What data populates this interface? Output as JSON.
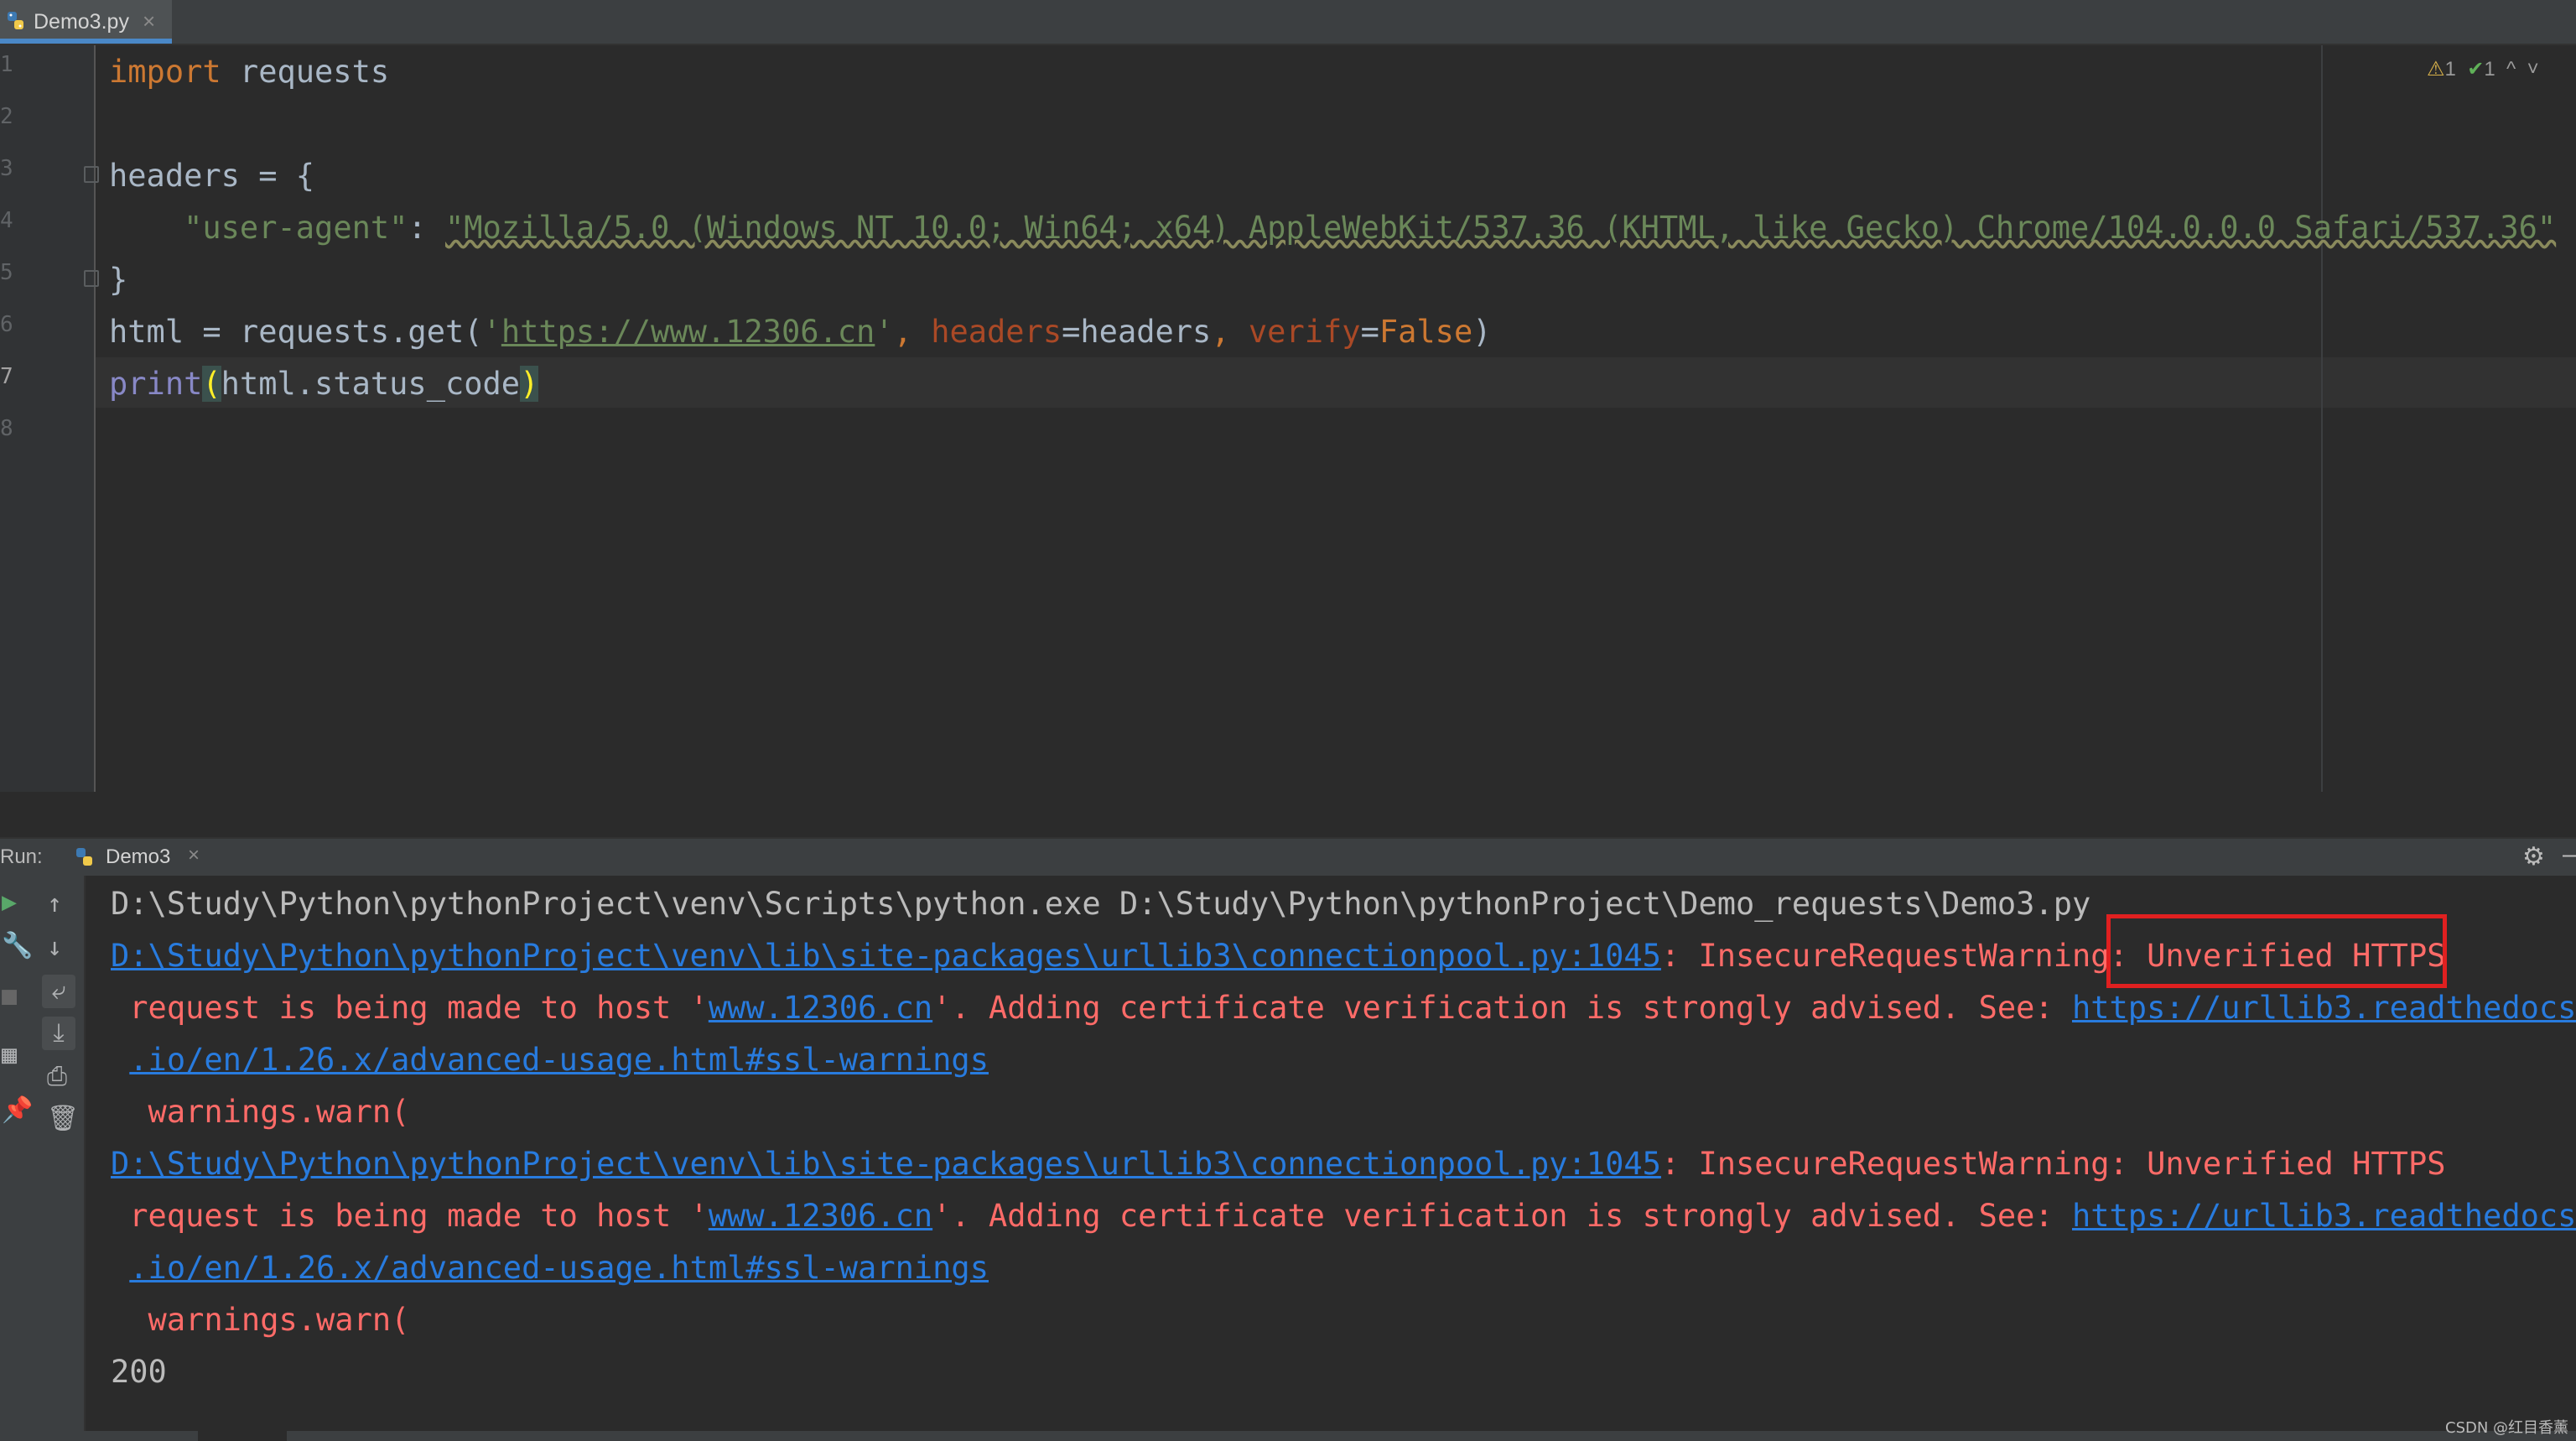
{
  "tab": {
    "filename": "Demo3.py",
    "close_glyph": "×",
    "icon": "python-file-icon"
  },
  "editor": {
    "line_numbers": [
      "1",
      "2",
      "3",
      "4",
      "5",
      "6",
      "7",
      "8"
    ],
    "inspections": {
      "warnings": "1",
      "checks": "1",
      "up": "^",
      "down": "˅"
    },
    "code": {
      "l1_kw": "import",
      "l1_rest": " requests",
      "l3": "headers = {",
      "l4_indent": "    ",
      "l4_key": "\"user-agent\"",
      "l4_colon": ": ",
      "l4_value": "\"Mozilla/5.0 (Windows NT 10.0; Win64; x64) AppleWebKit/537.36 (KHTML, like Gecko) Chrome/104.0.0.0 Safari/537.36\"",
      "l5": "}",
      "l6_a": "html = requests.get(",
      "l6_q1": "'",
      "l6_url": "https://www.12306.cn",
      "l6_q2": "'",
      "l6_comma1": ", ",
      "l6_p1": "headers",
      "l6_eq1": "=headers",
      "l6_comma2": ", ",
      "l6_p2": "verify",
      "l6_eq2": "=",
      "l6_false": "False",
      "l6_close": ")",
      "l7_fn": "print",
      "l7_open": "(",
      "l7_arg": "html.status_code",
      "l7_close": ")"
    }
  },
  "run_panel": {
    "label": "Run:",
    "config": "Demo3",
    "close_glyph": "×",
    "gear_glyph": "⚙",
    "minimize_glyph": "–"
  },
  "console": {
    "cmd": "D:\\Study\\Python\\pythonProject\\venv\\Scripts\\python.exe D:\\Study\\Python\\pythonProject\\Demo_requests\\Demo3.py",
    "warn_path": "D:\\Study\\Python\\pythonProject\\venv\\lib\\site-packages\\urllib3\\connectionpool.py:1045",
    "warn_head": ": InsecureRequestWarning: Unverified HTTPS",
    "warn_l2_a": " request is being made to host '",
    "warn_host": "www.12306.cn",
    "warn_l2_b": "'. Adding certificate verification is strongly advised. See: ",
    "warn_docs1": "https://urllib3.readthedocs",
    "warn_docs2": ".io/en/1.26.x/advanced-usage.html#ssl-warnings",
    "warn_call": "  warnings.warn(",
    "result": "200"
  },
  "watermark": "CSDN @红目香薰"
}
